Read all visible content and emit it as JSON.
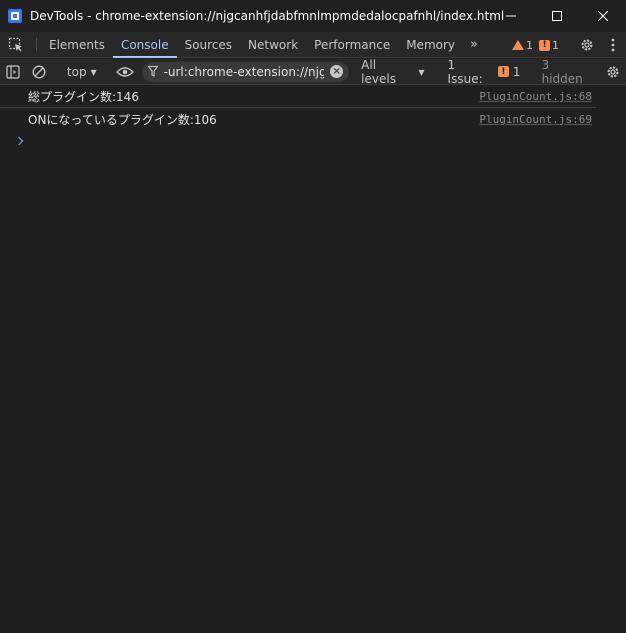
{
  "window": {
    "title": "DevTools - chrome-extension://njgcanhfjdabfmnlmpmdedalocpafnhl/index.html",
    "controls": [
      "minimize",
      "maximize",
      "close"
    ]
  },
  "tabs": {
    "items": [
      {
        "label": "Elements"
      },
      {
        "label": "Console",
        "active": true
      },
      {
        "label": "Sources"
      },
      {
        "label": "Network"
      },
      {
        "label": "Performance"
      },
      {
        "label": "Memory"
      }
    ],
    "warnings_count": "1",
    "errors_count": "1"
  },
  "toolbar": {
    "context": "top",
    "filter_value": "-url:chrome-extension://njgcanhfjdabfmnlmpmdedalocpafnhl",
    "levels": "All levels",
    "issues_label": "1 Issue:",
    "issues_count": "1",
    "hidden_label": "3 hidden"
  },
  "console": {
    "messages": [
      {
        "text": "総プラグイン数:146",
        "source": "PluginCount.js:68"
      },
      {
        "text": "ONになっているプラグイン数:106",
        "source": "PluginCount.js:69"
      }
    ]
  },
  "colors": {
    "accent": "#a8c7fa",
    "warning": "#f28b54",
    "background": "#1f1f1f"
  }
}
